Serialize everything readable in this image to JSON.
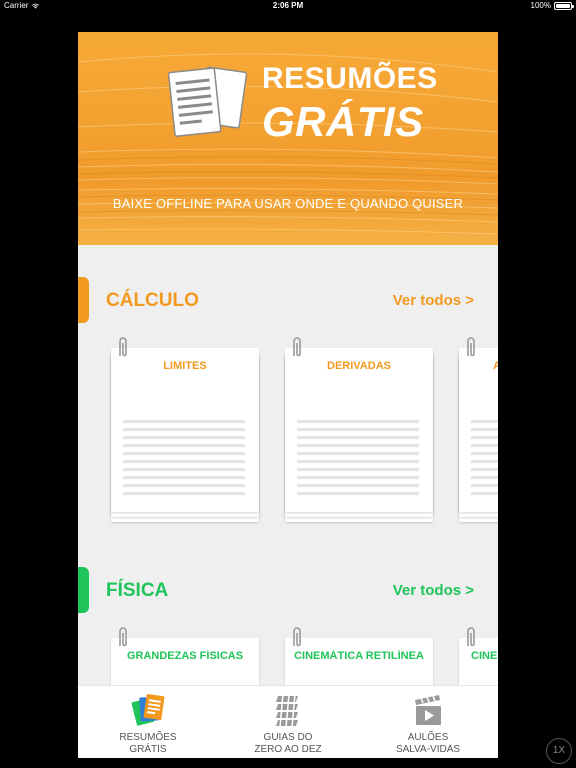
{
  "status_bar": {
    "carrier": "Carrier",
    "time": "2:06 PM",
    "battery": "100%"
  },
  "hero": {
    "title_line1": "RESUMÕES",
    "title_line2": "GRÁTIS",
    "subtitle": "BAIXE OFFLINE PARA USAR ONDE E QUANDO QUISER"
  },
  "sections": [
    {
      "title": "CÁLCULO",
      "link": "Ver todos >",
      "color": "#f29a1f",
      "cards": [
        "LIMITES",
        "DERIVADAS",
        "A"
      ]
    },
    {
      "title": "FÍSICA",
      "link": "Ver todos >",
      "color": "#1fc45a",
      "cards": [
        "GRANDEZAS FÍSICAS",
        "CINEMÁTICA RETILÍNEA",
        "CINE"
      ]
    }
  ],
  "tabbar": {
    "tabs": [
      {
        "label": "RESUMÕES\nGRÁTIS",
        "icon": "summaries-icon",
        "active": true
      },
      {
        "label": "GUIAS DO\nZERO AO DEZ",
        "icon": "guides-icon",
        "active": false
      },
      {
        "label": "AULÕES\nSALVA-VIDAS",
        "icon": "video-icon",
        "active": false
      }
    ]
  },
  "zoom_button": {
    "label": "1X"
  }
}
